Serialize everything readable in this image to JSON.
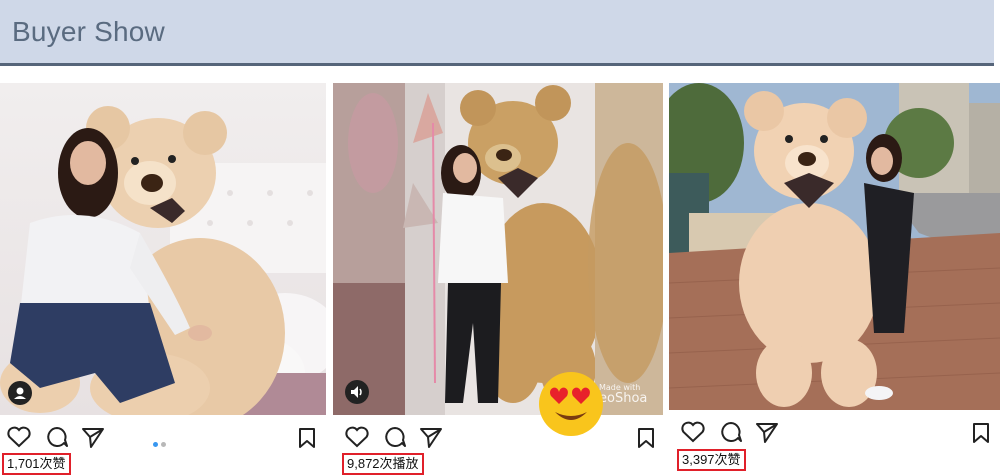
{
  "header": {
    "title": "Buyer Show"
  },
  "posts": [
    {
      "count_text": "1,701次赞",
      "badge": "person-icon"
    },
    {
      "count_text": "9,872次播放",
      "badge": "speaker-icon",
      "watermark": "Made with\neoShoa"
    },
    {
      "count_text": "3,397次赞"
    }
  ],
  "colors": {
    "highlight_box": "#e0202a",
    "header_bg": "#cfd8e8",
    "header_border": "#56657a",
    "carousel_dot_active": "#3897f0"
  }
}
